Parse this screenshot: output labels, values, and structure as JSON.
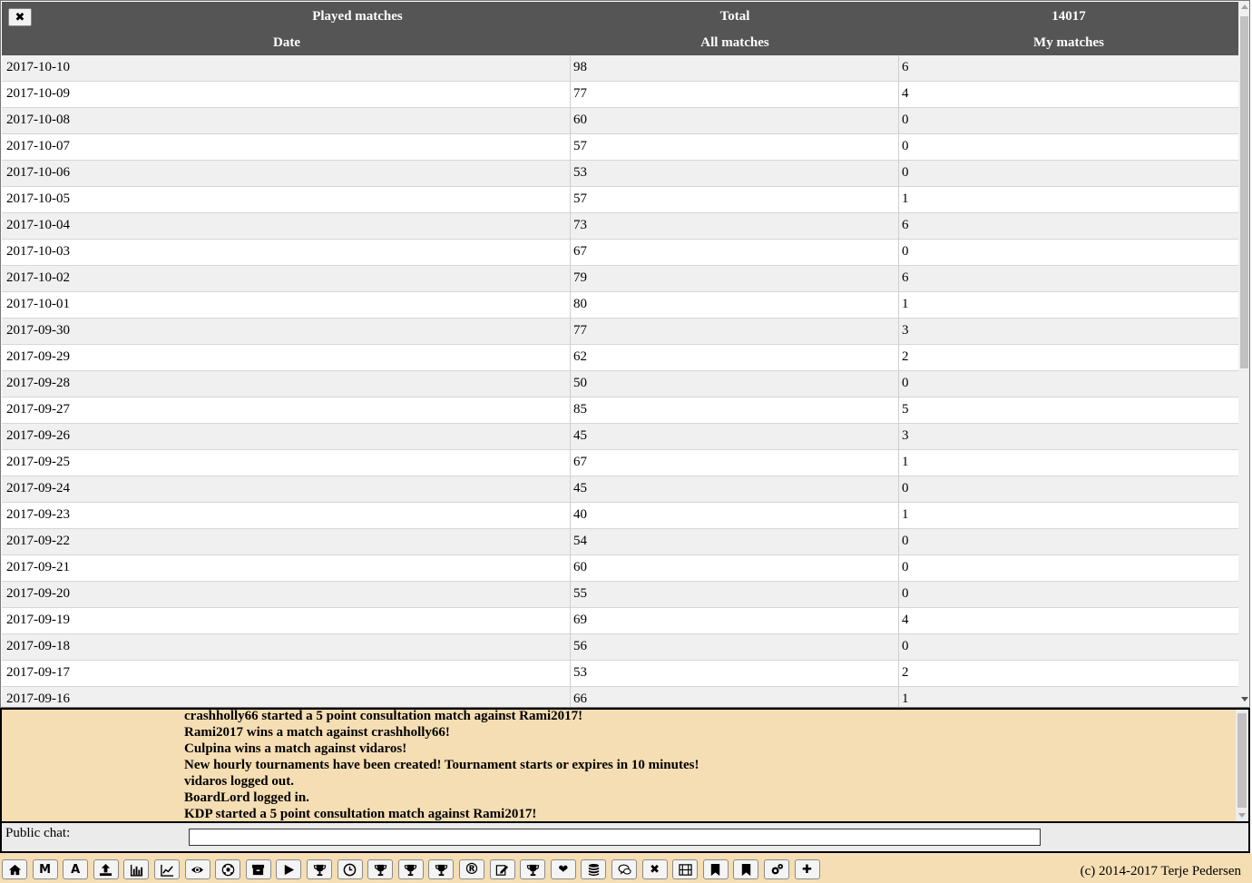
{
  "stats": {
    "title": "Played matches",
    "total_label": "Total",
    "total_value": "14017",
    "columns": [
      "Date",
      "All matches",
      "My matches"
    ],
    "rows": [
      [
        "2017-10-10",
        "98",
        "6"
      ],
      [
        "2017-10-09",
        "77",
        "4"
      ],
      [
        "2017-10-08",
        "60",
        "0"
      ],
      [
        "2017-10-07",
        "57",
        "0"
      ],
      [
        "2017-10-06",
        "53",
        "0"
      ],
      [
        "2017-10-05",
        "57",
        "1"
      ],
      [
        "2017-10-04",
        "73",
        "6"
      ],
      [
        "2017-10-03",
        "67",
        "0"
      ],
      [
        "2017-10-02",
        "79",
        "6"
      ],
      [
        "2017-10-01",
        "80",
        "1"
      ],
      [
        "2017-09-30",
        "77",
        "3"
      ],
      [
        "2017-09-29",
        "62",
        "2"
      ],
      [
        "2017-09-28",
        "50",
        "0"
      ],
      [
        "2017-09-27",
        "85",
        "5"
      ],
      [
        "2017-09-26",
        "45",
        "3"
      ],
      [
        "2017-09-25",
        "67",
        "1"
      ],
      [
        "2017-09-24",
        "45",
        "0"
      ],
      [
        "2017-09-23",
        "40",
        "1"
      ],
      [
        "2017-09-22",
        "54",
        "0"
      ],
      [
        "2017-09-21",
        "60",
        "0"
      ],
      [
        "2017-09-20",
        "55",
        "0"
      ],
      [
        "2017-09-19",
        "69",
        "4"
      ],
      [
        "2017-09-18",
        "56",
        "0"
      ],
      [
        "2017-09-17",
        "53",
        "2"
      ],
      [
        "2017-09-16",
        "66",
        "1"
      ]
    ]
  },
  "chat_log": [
    "crashholly66 started a 5 point consultation match against Rami2017!",
    "Rami2017 wins a match against crashholly66!",
    "Culpina wins a match against vidaros!",
    "New hourly tournaments have been created! Tournament starts or expires in 10 minutes!",
    "vidaros logged out.",
    "BoardLord logged in.",
    "KDP started a 5 point consultation match against Rami2017!"
  ],
  "chat_input": {
    "label": "Public chat:",
    "value": ""
  },
  "toolbar": {
    "buttons": [
      {
        "icon": "home-icon",
        "text": ""
      },
      {
        "icon": "m-icon",
        "text": "M"
      },
      {
        "icon": "a-icon",
        "text": "A"
      },
      {
        "icon": "upload-icon",
        "text": ""
      },
      {
        "icon": "bar-chart-icon",
        "text": ""
      },
      {
        "icon": "line-chart-icon",
        "text": ""
      },
      {
        "icon": "eye-icon",
        "text": ""
      },
      {
        "icon": "ball-icon",
        "text": ""
      },
      {
        "icon": "archive-icon",
        "text": ""
      },
      {
        "icon": "play-icon",
        "text": ""
      },
      {
        "icon": "trophy-icon",
        "text": ""
      },
      {
        "icon": "clock-icon",
        "text": ""
      },
      {
        "icon": "trophy-icon",
        "text": ""
      },
      {
        "icon": "trophy-icon",
        "text": ""
      },
      {
        "icon": "trophy-icon",
        "text": ""
      },
      {
        "icon": "registered-icon",
        "text": "®"
      },
      {
        "icon": "edit-icon",
        "text": ""
      },
      {
        "icon": "trophy-icon",
        "text": ""
      },
      {
        "icon": "heart-icon",
        "text": "❤"
      },
      {
        "icon": "database-icon",
        "text": ""
      },
      {
        "icon": "chat-icon",
        "text": ""
      },
      {
        "icon": "close-icon",
        "text": "✖"
      },
      {
        "icon": "film-icon",
        "text": ""
      },
      {
        "icon": "bookmark-icon",
        "text": ""
      },
      {
        "icon": "bookmark-icon",
        "text": ""
      },
      {
        "icon": "settings-icon",
        "text": ""
      },
      {
        "icon": "plus-icon",
        "text": "✚"
      }
    ],
    "copyright": "(c) 2014-2017 Terje Pedersen"
  },
  "colors": {
    "header_bg": "#555555",
    "chat_bg": "#f5deb3",
    "row_alt_bg": "#f0f0f0"
  }
}
